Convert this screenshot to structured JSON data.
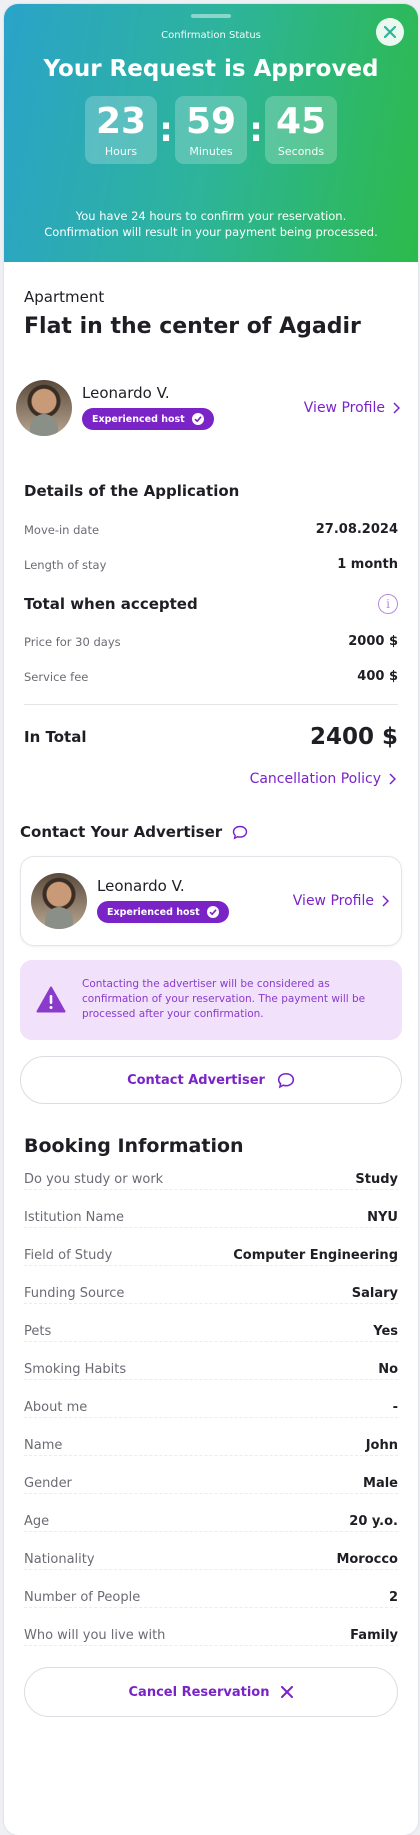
{
  "header": {
    "status_label": "Confirmation Status",
    "title": "Your Request is Approved",
    "timer": {
      "hours": "23",
      "hours_label": "Hours",
      "minutes": "59",
      "minutes_label": "Minutes",
      "seconds": "45",
      "seconds_label": "Seconds",
      "separator": ":"
    },
    "note_line1": "You have 24 hours to confirm your reservation.",
    "note_line2": "Confirmation will result in your payment being processed."
  },
  "listing": {
    "category": "Apartment",
    "title": "Flat in the center of Agadir"
  },
  "host": {
    "name": "Leonardo V.",
    "badge": "Experienced host",
    "view_profile": "View Profile"
  },
  "application": {
    "heading": "Details of the Application",
    "move_in_label": "Move-in date",
    "move_in_value": "27.08.2024",
    "stay_label": "Length of stay",
    "stay_value": "1 month"
  },
  "total": {
    "heading": "Total when accepted",
    "price_label": "Price for 30 days",
    "price_value": "2000 $",
    "fee_label": "Service fee",
    "fee_value": "400 $",
    "in_total_label": "In Total",
    "in_total_value": "2400 $",
    "cancellation_policy": "Cancellation Policy"
  },
  "contact": {
    "heading": "Contact Your Advertiser",
    "host_name": "Leonardo V.",
    "host_badge": "Experienced host",
    "view_profile": "View Profile",
    "warning": "Contacting the advertiser will be considered as confirmation of your reservation. The payment will be processed after your confirmation.",
    "button": "Contact Advertiser"
  },
  "booking": {
    "heading": "Booking Information",
    "rows": [
      {
        "label": "Do you study or work",
        "value": "Study"
      },
      {
        "label": "Istitution Name",
        "value": "NYU"
      },
      {
        "label": "Field of Study",
        "value": "Computer Engineering"
      },
      {
        "label": "Funding Source",
        "value": "Salary"
      },
      {
        "label": "Pets",
        "value": "Yes"
      },
      {
        "label": "Smoking Habits",
        "value": "No"
      },
      {
        "label": "About me",
        "value": "-"
      },
      {
        "label": "Name",
        "value": "John"
      },
      {
        "label": "Gender",
        "value": "Male"
      },
      {
        "label": "Age",
        "value": "20 y.o."
      },
      {
        "label": "Nationality",
        "value": "Morocco"
      },
      {
        "label": "Number of People",
        "value": "2"
      },
      {
        "label": "Who will you live with",
        "value": "Family"
      }
    ],
    "cancel_button": "Cancel Reservation"
  },
  "colors": {
    "accent": "#7a24c8",
    "header_start": "#2aa3c9",
    "header_end": "#2dba4a",
    "warning_bg": "#f1e1fb"
  }
}
